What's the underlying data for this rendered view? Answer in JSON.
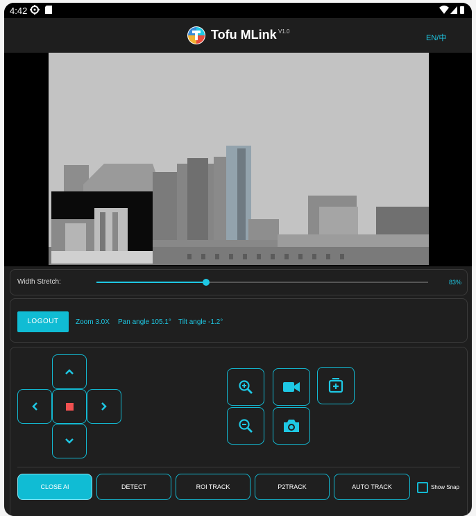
{
  "status_bar": {
    "time": "4:42",
    "icons": [
      "gear-icon",
      "sd-card-icon",
      "wifi-icon",
      "signal-icon",
      "battery-icon"
    ]
  },
  "header": {
    "title": "Tofu MLink",
    "version": "V1.0",
    "language": "EN/中"
  },
  "width_stretch": {
    "label": "Width Stretch:",
    "value": "83%",
    "level": 0.33
  },
  "camera": {
    "logout": "LOGOUT",
    "zoom": "Zoom 3.0X",
    "pan": "Pan angle 105.1°",
    "tilt": "Tilt angle -1.2°"
  },
  "controls": {
    "icons": [
      "chevron-up-icon",
      "chevron-left-icon",
      "stop-icon",
      "chevron-right-icon",
      "chevron-down-icon",
      "zoom-in-icon",
      "zoom-out-icon",
      "video-camera-icon",
      "camera-icon",
      "add-frame-icon"
    ]
  },
  "bottom": {
    "buttons": [
      "CLOSE AI",
      "DETECT",
      "ROI TRACK",
      "P2TRACK",
      "AUTO TRACK"
    ],
    "show_snap": "Show Snap"
  },
  "colors": {
    "accent": "#10bcd4",
    "background": "#1e1e1e",
    "stop": "#f05050"
  }
}
